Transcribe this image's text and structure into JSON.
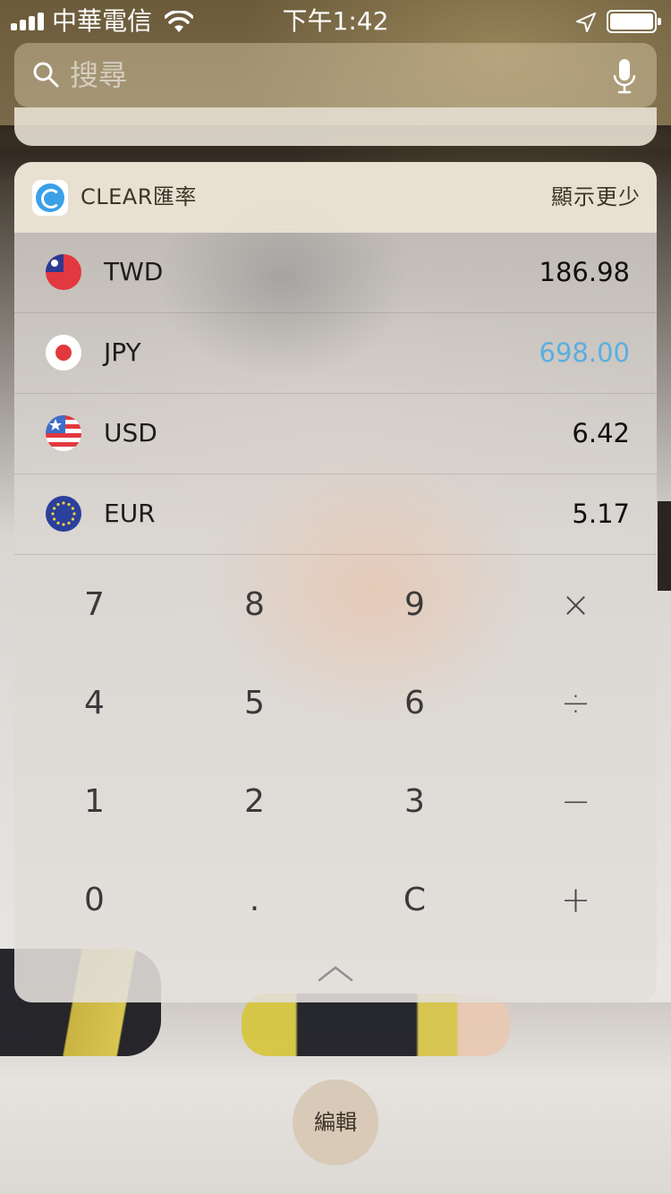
{
  "status_bar": {
    "carrier": "中華電信",
    "time": "下午1:42",
    "icons": [
      "signal-icon",
      "wifi-icon",
      "location-icon",
      "battery-icon"
    ]
  },
  "search": {
    "placeholder": "搜尋"
  },
  "widget": {
    "app_name": "CLEAR匯率",
    "show_less_label": "顯示更少",
    "currencies": [
      {
        "code": "TWD",
        "amount": "186.98",
        "flag": "taiwan-flag-icon",
        "active": false
      },
      {
        "code": "JPY",
        "amount": "698.00",
        "flag": "japan-flag-icon",
        "active": true
      },
      {
        "code": "USD",
        "amount": "6.42",
        "flag": "usa-flag-icon",
        "active": false
      },
      {
        "code": "EUR",
        "amount": "5.17",
        "flag": "eu-flag-icon",
        "active": false
      }
    ],
    "keypad": [
      [
        "7",
        "8",
        "9",
        "×"
      ],
      [
        "4",
        "5",
        "6",
        "÷"
      ],
      [
        "1",
        "2",
        "3",
        "−"
      ],
      [
        "0",
        ".",
        "C",
        "+"
      ]
    ],
    "active_color": "#5aaee0"
  },
  "edit_label": "編輯"
}
